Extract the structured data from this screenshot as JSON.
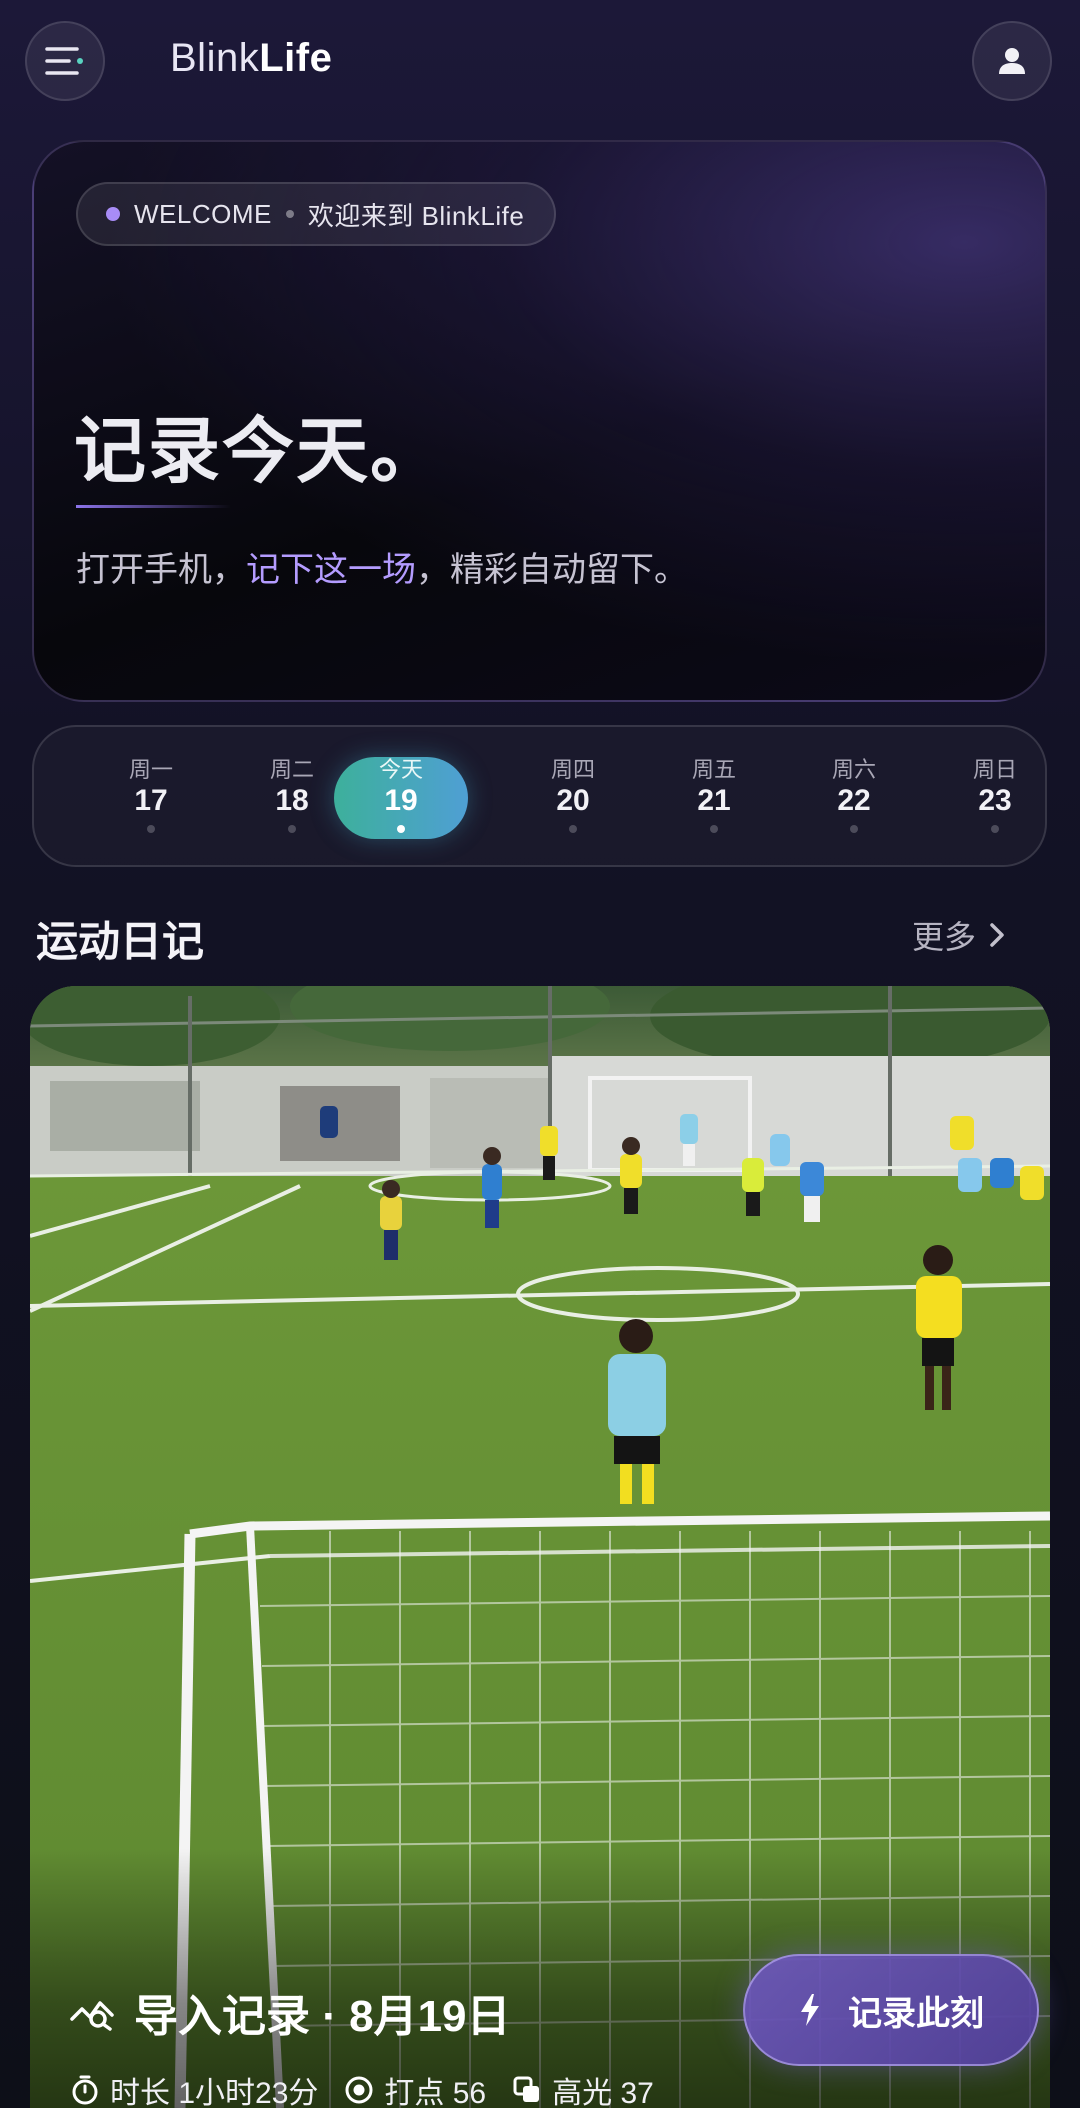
{
  "brand": {
    "light": "Blink",
    "bold": "Life"
  },
  "hero": {
    "chip_left": "WELCOME",
    "chip_right": "欢迎来到 BlinkLife",
    "title": "记录今天。",
    "subtitle_pre": "打开手机，",
    "subtitle_accent": "记下这一场",
    "subtitle_post": "，精彩自动留下。"
  },
  "week": [
    {
      "name": "周一",
      "num": "17"
    },
    {
      "name": "周二",
      "num": "18"
    },
    {
      "name": "今天",
      "num": "19"
    },
    {
      "name": "周四",
      "num": "20"
    },
    {
      "name": "周五",
      "num": "21"
    },
    {
      "name": "周六",
      "num": "22"
    },
    {
      "name": "周日",
      "num": "23"
    }
  ],
  "selected_day_index": 2,
  "section": {
    "title": "运动日记",
    "more": "更多"
  },
  "card": {
    "title": "导入记录 · 8月19日",
    "stats": {
      "duration": "时长 1小时23分",
      "points": "打点 56",
      "highlights": "高光 37"
    }
  },
  "record_button": "记录此刻",
  "icons": {
    "menu": "menu-icon",
    "profile": "person-icon",
    "more": "chevron-right-icon",
    "card": "activity-chart-icon",
    "duration": "timer-icon",
    "points": "target-icon",
    "highlights": "copy-icon",
    "record": "lightning-icon"
  },
  "colors": {
    "accent": "#a88cf6",
    "today_gradient_start": "#3db09b",
    "today_gradient_end": "#4f9fd4",
    "record_button": "#6e58be"
  }
}
